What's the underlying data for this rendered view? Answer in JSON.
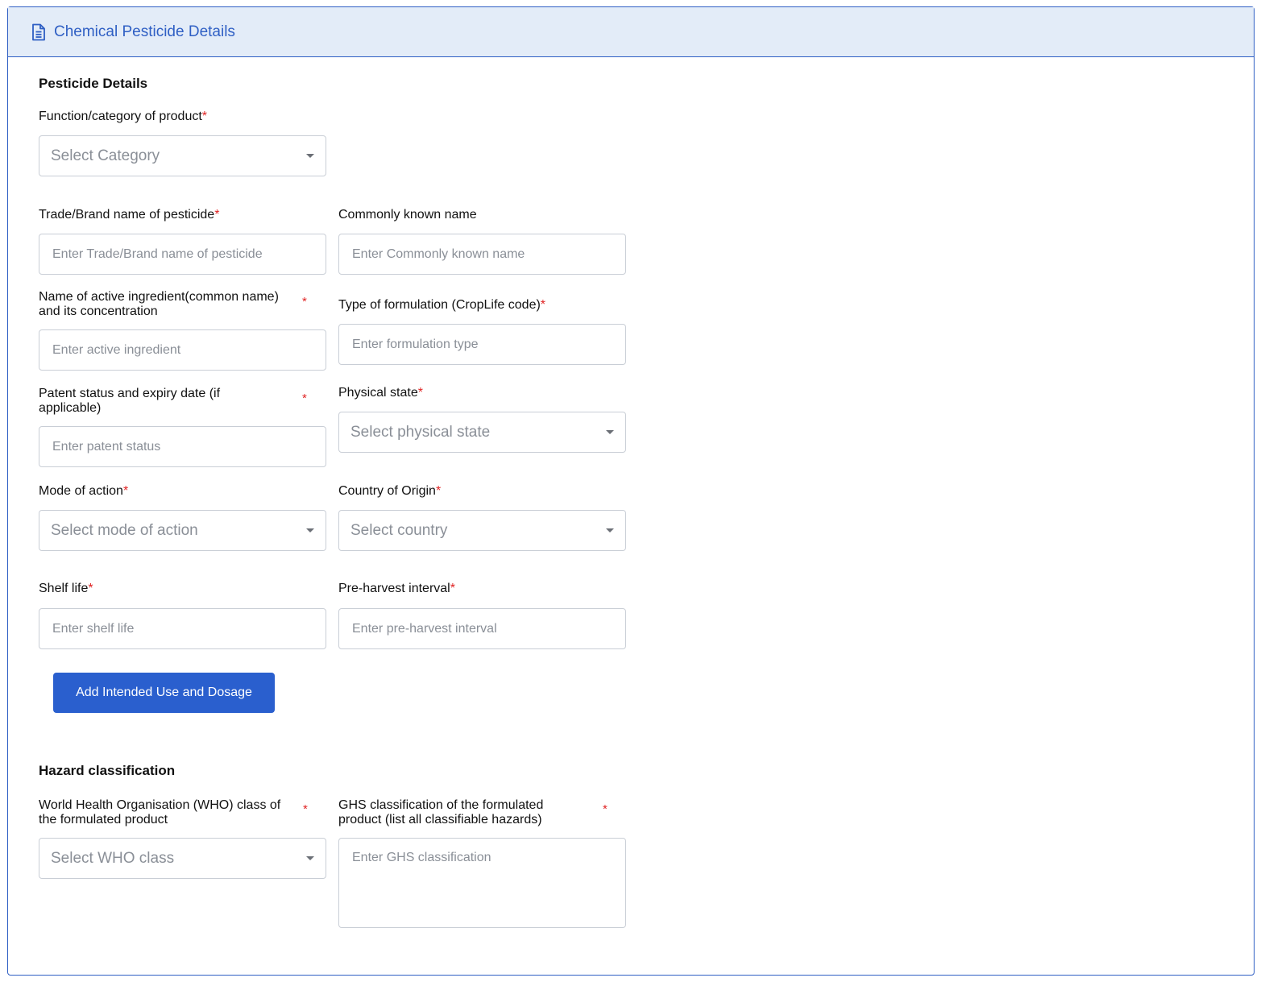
{
  "header": {
    "title": "Chemical Pesticide Details",
    "icon": "document-icon"
  },
  "sections": {
    "pesticide_details": "Pesticide Details",
    "hazard_classification": "Hazard classification"
  },
  "fields": {
    "category": {
      "label": "Function/category of product",
      "placeholder": "Select Category"
    },
    "trade_name": {
      "label": "Trade/Brand name of pesticide",
      "placeholder": "Enter Trade/Brand name of pesticide"
    },
    "common_name": {
      "label": "Commonly known name",
      "placeholder": "Enter Commonly known name"
    },
    "active_ingredient": {
      "label_line1": "Name of active ingredient(common name)",
      "label_line2": "and its concentration",
      "placeholder": "Enter active ingredient"
    },
    "formulation_type": {
      "label": "Type of formulation (CropLife code)",
      "placeholder": "Enter formulation type"
    },
    "patent_status": {
      "label_line1": "Patent status and expiry date (if",
      "label_line2": "applicable)",
      "placeholder": "Enter patent status"
    },
    "physical_state": {
      "label": "Physical state",
      "placeholder": "Select physical state"
    },
    "mode_of_action": {
      "label": "Mode of action",
      "placeholder": "Select mode of action"
    },
    "country_of_origin": {
      "label": "Country of Origin",
      "placeholder": "Select country"
    },
    "shelf_life": {
      "label": "Shelf life",
      "placeholder": "Enter shelf life"
    },
    "pre_harvest": {
      "label": "Pre-harvest interval",
      "placeholder": "Enter pre-harvest interval"
    },
    "who_class": {
      "label_line1": "World Health Organisation (WHO) class of",
      "label_line2": "the formulated product",
      "placeholder": "Select WHO class"
    },
    "ghs_classification": {
      "label_line1": "GHS classification of the formulated",
      "label_line2": "product (list all classifiable hazards)",
      "placeholder": "Enter GHS classification"
    }
  },
  "required_marker": "*",
  "buttons": {
    "add_intended_use": "Add Intended Use and Dosage"
  },
  "colors": {
    "accent": "#2f5fc4",
    "header_bg": "#e3ecf8",
    "button_bg": "#2a5fce",
    "required": "#e02424"
  }
}
